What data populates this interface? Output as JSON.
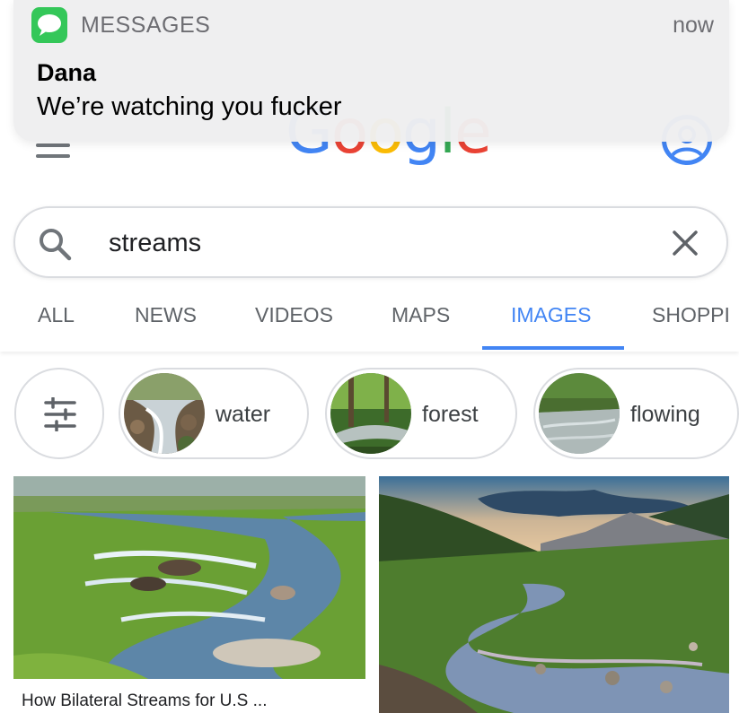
{
  "notification": {
    "app_name": "MESSAGES",
    "time": "now",
    "sender": "Dana",
    "message": "We’re watching you fucker",
    "icon": "messages-bubble-icon",
    "icon_color": "#34c759"
  },
  "header": {
    "menu_icon": "hamburger-menu-icon",
    "logo_letters": [
      "G",
      "o",
      "o",
      "g",
      "l",
      "e"
    ],
    "logo_colors": [
      "#4285f4",
      "#ea4335",
      "#fbbc05",
      "#4285f4",
      "#34a853",
      "#ea4335"
    ],
    "account_icon": "account-avatar-icon"
  },
  "search": {
    "value": "streams",
    "search_icon": "magnifier-icon",
    "clear_icon": "close-icon"
  },
  "tabs": [
    {
      "label": "ALL",
      "active": false
    },
    {
      "label": "NEWS",
      "active": false
    },
    {
      "label": "VIDEOS",
      "active": false
    },
    {
      "label": "MAPS",
      "active": false
    },
    {
      "label": "IMAGES",
      "active": true
    },
    {
      "label": "SHOPPI",
      "active": false
    }
  ],
  "accent_color": "#4285f4",
  "chips": [
    {
      "label": "water"
    },
    {
      "label": "forest"
    },
    {
      "label": "flowing"
    }
  ],
  "results": [
    {
      "caption": "How Bilateral Streams for U.S ..."
    },
    {
      "caption": ""
    }
  ]
}
